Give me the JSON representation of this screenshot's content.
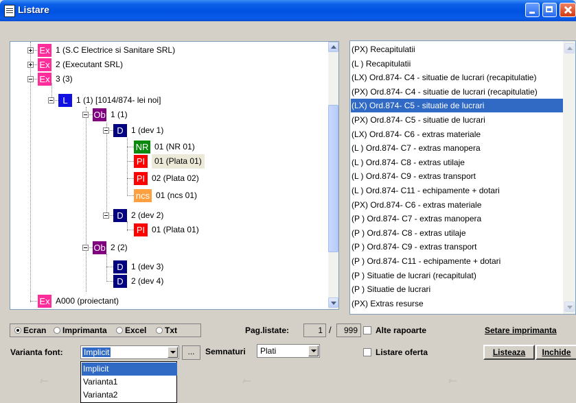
{
  "window": {
    "title": "Listare"
  },
  "tree": [
    {
      "badge": "Ex",
      "color": "#ff2d9b",
      "label": "1 (S.C Electrice si Sanitare SRL)",
      "expander": "plus"
    },
    {
      "badge": "Ex",
      "color": "#ff2d9b",
      "label": "2 (Executant SRL)",
      "expander": "plus"
    },
    {
      "badge": "Ex",
      "color": "#ff2d9b",
      "label": "3 (3)",
      "expander": "minus"
    },
    {
      "badge": "L",
      "color": "#1010e0",
      "label": "1 (1) [1014/874- lei noi]",
      "expander": "minus"
    },
    {
      "badge": "Ob",
      "color": "#800080",
      "label": "1 (1)",
      "expander": "minus"
    },
    {
      "badge": "D",
      "color": "#000080",
      "label": "1 (dev 1)",
      "expander": "minus"
    },
    {
      "badge": "NR",
      "color": "#0a8a0a",
      "label": "01 (NR 01)"
    },
    {
      "badge": "PI",
      "color": "#ff0000",
      "label": "01 (Plata 01)",
      "selected": true
    },
    {
      "badge": "PI",
      "color": "#ff0000",
      "label": "02 (Plata 02)"
    },
    {
      "badge": "ncs",
      "color": "#ffa040",
      "label": "01 (ncs 01)"
    },
    {
      "badge": "D",
      "color": "#000080",
      "label": "2 (dev 2)",
      "expander": "minus"
    },
    {
      "badge": "PI",
      "color": "#ff0000",
      "label": "01 (Plata 01)"
    },
    {
      "badge": "Ob",
      "color": "#800080",
      "label": "2 (2)",
      "expander": "minus"
    },
    {
      "badge": "D",
      "color": "#000080",
      "label": "1 (dev 3)"
    },
    {
      "badge": "D",
      "color": "#000080",
      "label": "2 (dev 4)"
    },
    {
      "badge": "Ex",
      "color": "#ff2d9b",
      "label": "A000 (proiectant)"
    }
  ],
  "reports": [
    "(PX) Recapitulatii",
    "(L ) Recapitulatii",
    "(LX) Ord.874- C4 - situatie de lucrari (recapitulatie)",
    "(PX) Ord.874- C4 - situatie de lucrari (recapitulatie)",
    "(LX) Ord.874- C5 - situatie de lucrari",
    "(PX) Ord.874- C5 - situatie de lucrari",
    "(LX) Ord.874- C6 - extras materiale",
    "(L ) Ord.874- C7 - extras manopera",
    "(L ) Ord.874- C8 - extras utilaje",
    "(L ) Ord.874- C9 - extras transport",
    "(L ) Ord.874- C11 - echipamente + dotari",
    "(PX) Ord.874- C6 - extras materiale",
    "(P ) Ord.874- C7 - extras manopera",
    "(P ) Ord.874- C8 - extras utilaje",
    "(P ) Ord.874- C9 - extras transport",
    "(P ) Ord.874- C11 - echipamente + dotari",
    "(P ) Situatie de lucrari (recapitulat)",
    "(P ) Situatie de lucrari",
    "(PX) Extras resurse"
  ],
  "output": {
    "ecran": "Ecran",
    "imprimanta": "Imprimanta",
    "excel": "Excel",
    "txt": "Txt"
  },
  "pages": {
    "label": "Pag.listate:",
    "from": "1",
    "sep": "/",
    "to": "999"
  },
  "options": {
    "alte_rapoarte": "Alte rapoarte",
    "listare_oferta": "Listare oferta"
  },
  "buttons": {
    "setare_imprimanta": "Setare imprimanta",
    "listeaza": "Listeaza",
    "inchide": "Inchide",
    "ellipsis": "..."
  },
  "font": {
    "label": "Varianta font:",
    "value": "Implicit",
    "options": [
      "Implicit",
      "Varianta1",
      "Varianta2"
    ]
  },
  "semnaturi": {
    "label": "Semnaturi",
    "value": "Plati"
  },
  "colors": {
    "selection": "#316ac5",
    "titlebar": "#0052e0",
    "face": "#d4d0c8"
  }
}
